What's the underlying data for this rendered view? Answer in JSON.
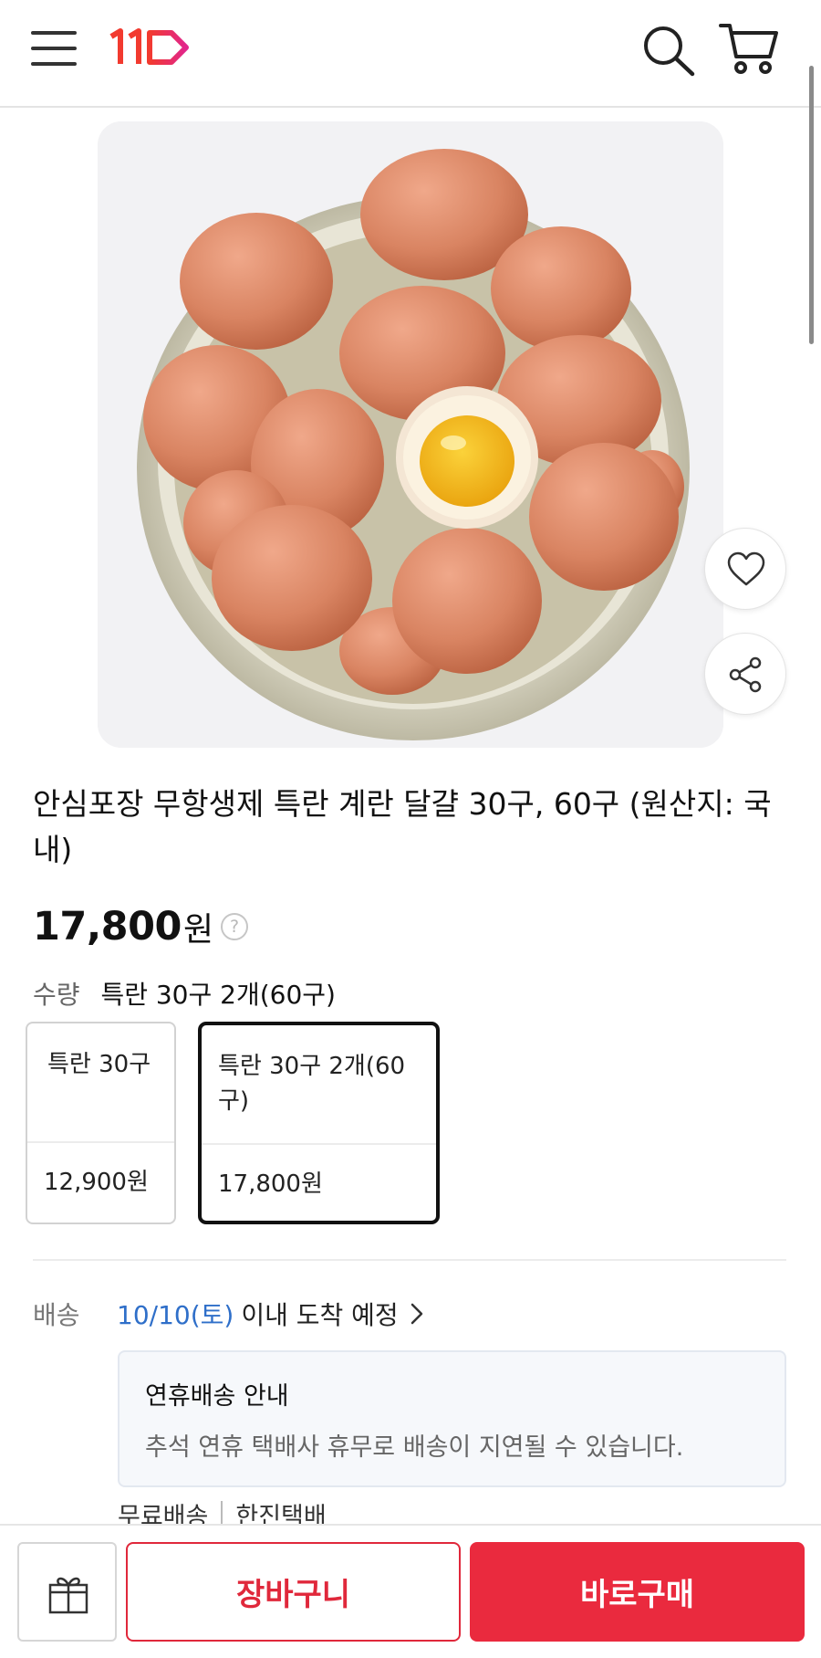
{
  "header": {
    "logo_text": "11",
    "brand_color": "#e3254b",
    "icons": [
      "hamburger-menu-icon",
      "search-icon",
      "cart-icon"
    ]
  },
  "product": {
    "title": "안심포장 무항생제 특란 계란 달걀 30구, 60구 (원산지: 국내)",
    "price": "17,800",
    "price_unit": "원",
    "help_symbol": "?",
    "image_icons": [
      "heart-icon",
      "share-icon"
    ]
  },
  "quantity": {
    "label": "수량",
    "selected": "특란 30구 2개(60구)",
    "options": [
      {
        "name": "특란 30구",
        "price": "12,900원",
        "selected": false
      },
      {
        "name": "특란 30구 2개(60구)",
        "price": "17,800원",
        "selected": true
      }
    ]
  },
  "delivery": {
    "label": "배송",
    "date": "10/10(토)",
    "text": "이내 도착 예정",
    "notice_title": "연휴배송 안내",
    "notice_body": "추석 연휴 택배사 휴무로 배송이 지연될 수 있습니다.",
    "shipping_fee": "무료배송",
    "carrier": "한진택배"
  },
  "bottom_bar": {
    "cart_label": "장바구니",
    "buy_label": "바로구매",
    "accent_color": "#ea2a3e"
  }
}
